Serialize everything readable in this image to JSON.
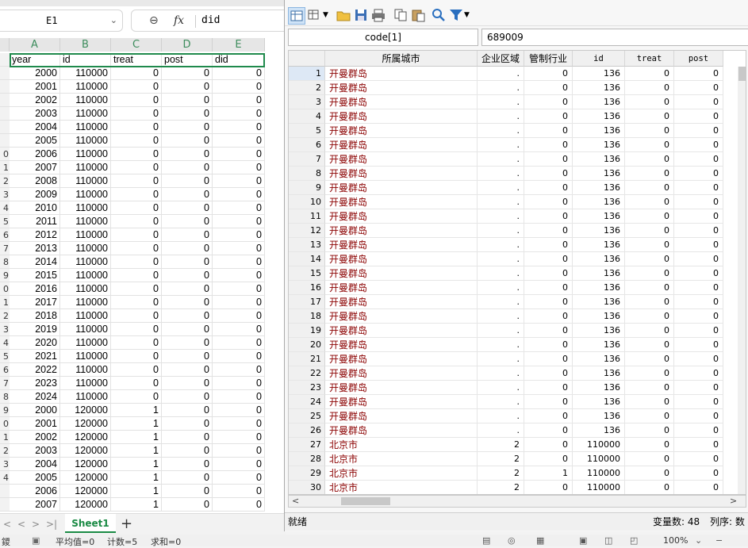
{
  "spreadsheet": {
    "name_box": "E1",
    "formula_value": "did",
    "columns": [
      "A",
      "B",
      "C",
      "D",
      "E"
    ],
    "row_numbers": [
      "",
      "",
      "",
      "",
      "",
      "",
      "",
      "0",
      "1",
      "2",
      "3",
      "4",
      "5",
      "6",
      "7",
      "8",
      "9",
      "0",
      "1",
      "2",
      "3",
      "4",
      "5",
      "6",
      "7",
      "8",
      "9",
      "0",
      "1",
      "2",
      "3",
      "4"
    ],
    "header_row": [
      "year",
      "id",
      "treat",
      "post",
      "did"
    ],
    "rows": [
      [
        "2000",
        "110000",
        "0",
        "0",
        "0"
      ],
      [
        "2001",
        "110000",
        "0",
        "0",
        "0"
      ],
      [
        "2002",
        "110000",
        "0",
        "0",
        "0"
      ],
      [
        "2003",
        "110000",
        "0",
        "0",
        "0"
      ],
      [
        "2004",
        "110000",
        "0",
        "0",
        "0"
      ],
      [
        "2005",
        "110000",
        "0",
        "0",
        "0"
      ],
      [
        "2006",
        "110000",
        "0",
        "0",
        "0"
      ],
      [
        "2007",
        "110000",
        "0",
        "0",
        "0"
      ],
      [
        "2008",
        "110000",
        "0",
        "0",
        "0"
      ],
      [
        "2009",
        "110000",
        "0",
        "0",
        "0"
      ],
      [
        "2010",
        "110000",
        "0",
        "0",
        "0"
      ],
      [
        "2011",
        "110000",
        "0",
        "0",
        "0"
      ],
      [
        "2012",
        "110000",
        "0",
        "0",
        "0"
      ],
      [
        "2013",
        "110000",
        "0",
        "0",
        "0"
      ],
      [
        "2014",
        "110000",
        "0",
        "0",
        "0"
      ],
      [
        "2015",
        "110000",
        "0",
        "0",
        "0"
      ],
      [
        "2016",
        "110000",
        "0",
        "0",
        "0"
      ],
      [
        "2017",
        "110000",
        "0",
        "0",
        "0"
      ],
      [
        "2018",
        "110000",
        "0",
        "0",
        "0"
      ],
      [
        "2019",
        "110000",
        "0",
        "0",
        "0"
      ],
      [
        "2020",
        "110000",
        "0",
        "0",
        "0"
      ],
      [
        "2021",
        "110000",
        "0",
        "0",
        "0"
      ],
      [
        "2022",
        "110000",
        "0",
        "0",
        "0"
      ],
      [
        "2023",
        "110000",
        "0",
        "0",
        "0"
      ],
      [
        "2024",
        "110000",
        "0",
        "0",
        "0"
      ],
      [
        "2000",
        "120000",
        "1",
        "0",
        "0"
      ],
      [
        "2001",
        "120000",
        "1",
        "0",
        "0"
      ],
      [
        "2002",
        "120000",
        "1",
        "0",
        "0"
      ],
      [
        "2003",
        "120000",
        "1",
        "0",
        "0"
      ],
      [
        "2004",
        "120000",
        "1",
        "0",
        "0"
      ],
      [
        "2005",
        "120000",
        "1",
        "0",
        "0"
      ],
      [
        "2006",
        "120000",
        "1",
        "0",
        "0"
      ],
      [
        "2007",
        "120000",
        "1",
        "0",
        "0"
      ]
    ],
    "sheet_tab": "Sheet1",
    "nav": [
      "<",
      "<",
      ">",
      ">|"
    ],
    "add_sheet": "+",
    "status": {
      "corner": "鑁",
      "average": "平均值=0",
      "count": "计数=5",
      "sum": "求和=0",
      "zoom": "100%"
    }
  },
  "stata": {
    "var_name": "code[1]",
    "var_value": "689009",
    "columns": [
      "所属城市",
      "企业区域",
      "管制行业",
      "id",
      "treat",
      "post"
    ],
    "rows": [
      [
        "1",
        "开曼群岛",
        ".",
        "0",
        "136",
        "0",
        "0"
      ],
      [
        "2",
        "开曼群岛",
        ".",
        "0",
        "136",
        "0",
        "0"
      ],
      [
        "3",
        "开曼群岛",
        ".",
        "0",
        "136",
        "0",
        "0"
      ],
      [
        "4",
        "开曼群岛",
        ".",
        "0",
        "136",
        "0",
        "0"
      ],
      [
        "5",
        "开曼群岛",
        ".",
        "0",
        "136",
        "0",
        "0"
      ],
      [
        "6",
        "开曼群岛",
        ".",
        "0",
        "136",
        "0",
        "0"
      ],
      [
        "7",
        "开曼群岛",
        ".",
        "0",
        "136",
        "0",
        "0"
      ],
      [
        "8",
        "开曼群岛",
        ".",
        "0",
        "136",
        "0",
        "0"
      ],
      [
        "9",
        "开曼群岛",
        ".",
        "0",
        "136",
        "0",
        "0"
      ],
      [
        "10",
        "开曼群岛",
        ".",
        "0",
        "136",
        "0",
        "0"
      ],
      [
        "11",
        "开曼群岛",
        ".",
        "0",
        "136",
        "0",
        "0"
      ],
      [
        "12",
        "开曼群岛",
        ".",
        "0",
        "136",
        "0",
        "0"
      ],
      [
        "13",
        "开曼群岛",
        ".",
        "0",
        "136",
        "0",
        "0"
      ],
      [
        "14",
        "开曼群岛",
        ".",
        "0",
        "136",
        "0",
        "0"
      ],
      [
        "15",
        "开曼群岛",
        ".",
        "0",
        "136",
        "0",
        "0"
      ],
      [
        "16",
        "开曼群岛",
        ".",
        "0",
        "136",
        "0",
        "0"
      ],
      [
        "17",
        "开曼群岛",
        ".",
        "0",
        "136",
        "0",
        "0"
      ],
      [
        "18",
        "开曼群岛",
        ".",
        "0",
        "136",
        "0",
        "0"
      ],
      [
        "19",
        "开曼群岛",
        ".",
        "0",
        "136",
        "0",
        "0"
      ],
      [
        "20",
        "开曼群岛",
        ".",
        "0",
        "136",
        "0",
        "0"
      ],
      [
        "21",
        "开曼群岛",
        ".",
        "0",
        "136",
        "0",
        "0"
      ],
      [
        "22",
        "开曼群岛",
        ".",
        "0",
        "136",
        "0",
        "0"
      ],
      [
        "23",
        "开曼群岛",
        ".",
        "0",
        "136",
        "0",
        "0"
      ],
      [
        "24",
        "开曼群岛",
        ".",
        "0",
        "136",
        "0",
        "0"
      ],
      [
        "25",
        "开曼群岛",
        ".",
        "0",
        "136",
        "0",
        "0"
      ],
      [
        "26",
        "开曼群岛",
        ".",
        "0",
        "136",
        "0",
        "0"
      ],
      [
        "27",
        "北京市",
        "2",
        "0",
        "110000",
        "0",
        "0"
      ],
      [
        "28",
        "北京市",
        "2",
        "0",
        "110000",
        "0",
        "0"
      ],
      [
        "29",
        "北京市",
        "2",
        "1",
        "110000",
        "0",
        "0"
      ],
      [
        "30",
        "北京市",
        "2",
        "0",
        "110000",
        "0",
        "0"
      ]
    ],
    "status_left": "就绪",
    "var_count": "变量数: 48",
    "order": "列序: 数",
    "colors": {
      "string_text": "#8b0000",
      "accent": "#1f6fd1"
    }
  }
}
